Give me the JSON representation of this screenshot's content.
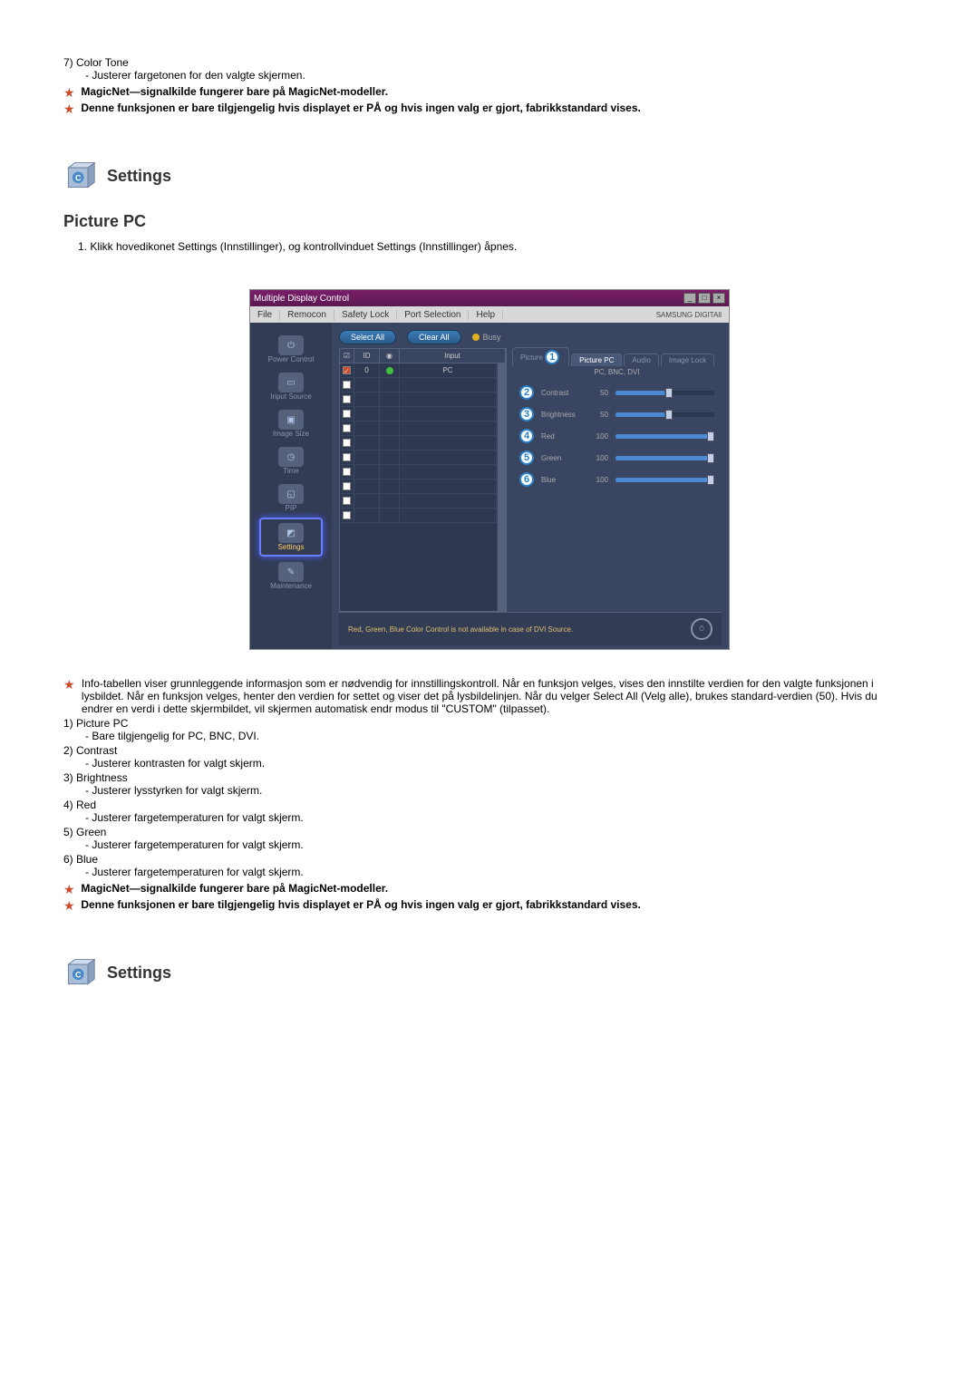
{
  "top": {
    "n7": "7)  Color Tone",
    "n7_sub": "- Justerer fargetonen for den valgte skjermen.",
    "note1": "MagicNet—signalkilde fungerer bare på MagicNet-modeller.",
    "note2": "Denne funksjonen er bare tilgjengelig hvis displayet er PÅ og hvis ingen valg er gjort, fabrikkstandard vises."
  },
  "settings_title": "Settings",
  "picture_pc_title": "Picture PC",
  "intro_1": "1.  Klikk hovedikonet Settings (Innstillinger), og kontrollvinduet Settings (Innstillinger) åpnes.",
  "app": {
    "title": "Multiple Display Control",
    "menu": {
      "file": "File",
      "remocon": "Remocon",
      "safety": "Safety Lock",
      "port": "Port Selection",
      "help": "Help"
    },
    "brand": "SAMSUNG DIGITAll",
    "sidebar": {
      "power": "Power Control",
      "input": "Input Source",
      "image": "Image Size",
      "time": "Time",
      "pip": "PIP",
      "settings": "Settings",
      "maint": "Maintenance"
    },
    "buttons": {
      "select_all": "Select All",
      "clear_all": "Clear All",
      "busy": "Busy"
    },
    "grid": {
      "h_id": "ID",
      "h_stat": "",
      "h_input": "Input",
      "row0_id": "0",
      "row0_input": "PC"
    },
    "tabs": {
      "picture": "Picture",
      "picture_pc": "Picture PC",
      "audio": "Audio",
      "image_lock": "Image Lock"
    },
    "sublabel": "PC, BNC, DVI",
    "sliders": {
      "contrast": {
        "lbl": "Contrast",
        "val": "50"
      },
      "brightness": {
        "lbl": "Brightness",
        "val": "50"
      },
      "red": {
        "lbl": "Red",
        "val": "100"
      },
      "green": {
        "lbl": "Green",
        "val": "100"
      },
      "blue": {
        "lbl": "Blue",
        "val": "100"
      }
    },
    "bottom_note": "Red, Green, Blue Color Control is not available in case of DVI Source."
  },
  "below": {
    "info": "Info-tabellen viser grunnleggende informasjon som er nødvendig for innstillingskontroll. Når en funksjon velges, vises den innstilte verdien for den valgte funksjonen i lysbildet. Når en funksjon velges, henter den verdien for settet og viser det på lysbildelinjen. Når du velger Select All (Velg alle), brukes standard-verdien (50). Hvis du endrer en verdi i dette skjermbildet, vil skjermen automatisk endr modus til \"CUSTOM\" (tilpasset).",
    "n1": "1)  Picture PC",
    "n1_sub": "- Bare tilgjengelig for PC, BNC, DVI.",
    "n2": "2)  Contrast",
    "n2_sub": "- Justerer kontrasten for valgt skjerm.",
    "n3": "3)  Brightness",
    "n3_sub": "- Justerer lysstyrken for valgt skjerm.",
    "n4": "4)  Red",
    "n4_sub": "- Justerer fargetemperaturen for valgt skjerm.",
    "n5": "5)  Green",
    "n5_sub": "- Justerer fargetemperaturen for valgt skjerm.",
    "n6": "6)  Blue",
    "n6_sub": "- Justerer fargetemperaturen for valgt skjerm.",
    "note1": "MagicNet—signalkilde fungerer bare på MagicNet-modeller.",
    "note2": "Denne funksjonen er bare tilgjengelig hvis displayet er PÅ og hvis ingen valg er gjort, fabrikkstandard vises."
  },
  "settings_title_2": "Settings"
}
